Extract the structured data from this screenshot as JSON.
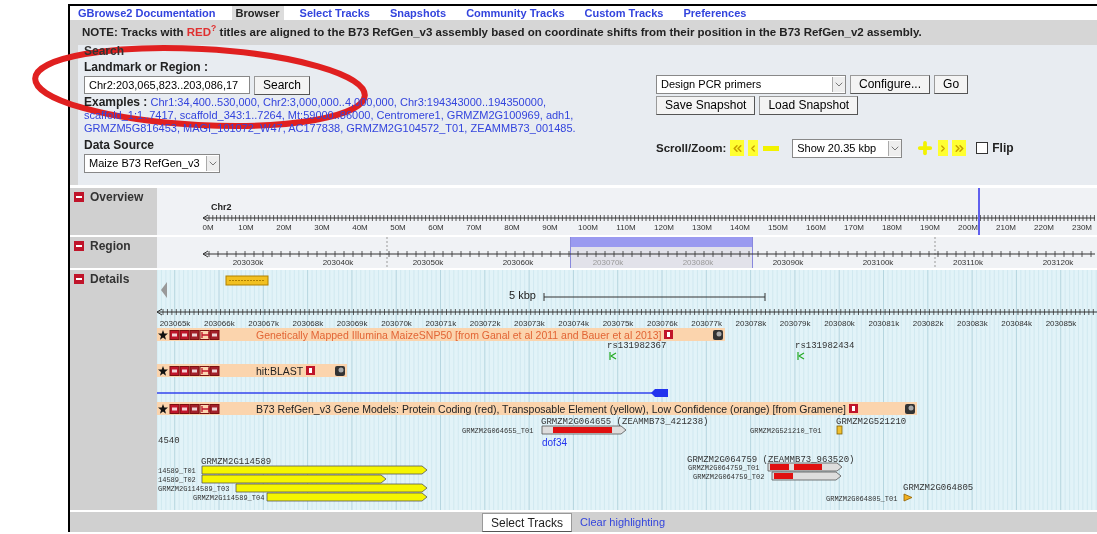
{
  "tabs": [
    {
      "label": "GBrowse2 Documentation",
      "selected": false
    },
    {
      "label": "Browser",
      "selected": true
    },
    {
      "label": "Select Tracks",
      "selected": false
    },
    {
      "label": "Snapshots",
      "selected": false
    },
    {
      "label": "Community Tracks",
      "selected": false
    },
    {
      "label": "Custom Tracks",
      "selected": false
    },
    {
      "label": "Preferences",
      "selected": false
    }
  ],
  "note": {
    "prefix": "NOTE: Tracks with",
    "highlight": "RED$^{?}$",
    "suffix": "titles are aligned to the B73 RefGen_v3 assembly based on coordinate shifts from their position in the B73 RefGen_v2 assembly."
  },
  "search": {
    "heading": "Search",
    "landmark_label": "Landmark or Region :",
    "landmark_value": "Chr2:203,065,823..203,086,17",
    "search_button": "Search",
    "examples_label": "Examples :",
    "examples": "Chr1:34,400..530,000, Chr2:3,000,000..4,000,000, Chr3:194343000..194350000, scaffold_1:1..7417, scaffold_343:1..7264, Mt:59000..86000, Centromere1, GRMZM2G100969, adh1, GRMZM5G816453, MAGI_101072_W47, AC177838, GRMZM2G104572_T01, ZEAMMB73_001485.",
    "data_source_label": "Data Source",
    "data_source": "Maize B73 RefGen_v3"
  },
  "tools": {
    "plugin": "Design PCR primers",
    "configure_button": "Configure...",
    "go_button": "Go",
    "snapshot_buttons": [
      "Save Snapshot",
      "Load Snapshot"
    ],
    "scroll_zoom_label": "Scroll/Zoom:",
    "zoom": "Show 20.35 kbp",
    "flip": {
      "label": "Flip",
      "checked": false
    }
  },
  "panels": [
    {
      "label": "Overview"
    },
    {
      "label": "Region"
    },
    {
      "label": "Details"
    }
  ],
  "overview": {
    "chromosome": "Chr2",
    "ticks": [
      "0M",
      "10M",
      "20M",
      "30M",
      "40M",
      "50M",
      "60M",
      "70M",
      "80M",
      "90M",
      "100M",
      "110M",
      "120M",
      "130M",
      "140M",
      "150M",
      "160M",
      "170M",
      "180M",
      "190M",
      "200M",
      "210M",
      "220M",
      "230M"
    ]
  },
  "region": {
    "ticks": [
      "203030k",
      "203040k",
      "203050k",
      "203060k",
      "203070k",
      "203080k",
      "203090k",
      "203100k",
      "203110k",
      "203120k"
    ]
  },
  "details": {
    "scale": "5 kbp",
    "ticks": [
      "203065k",
      "203066k",
      "203067k",
      "203068k",
      "203069k",
      "203070k",
      "203071k",
      "203072k",
      "203073k",
      "203074k",
      "203075k",
      "203076k",
      "203077k",
      "203078k",
      "203079k",
      "203080k",
      "203081k",
      "203082k",
      "203083k",
      "203084k",
      "203085k"
    ],
    "tracks": [
      {
        "title": "Genetically Mapped Illumina MaizeSNP50 [from Ganal et al 2011 and Bauer et al 2013]",
        "realigned": true
      },
      {
        "title": "hit:BLAST",
        "realigned": false
      },
      {
        "title": "B73 RefGen_v3 Gene Models: Protein Coding (red), Transposable Element (yellow), Low Confidence (orange) [from Gramene]",
        "realigned": false
      }
    ],
    "labels": [
      {
        "kind": "name",
        "text": "rs131982367"
      },
      {
        "kind": "name",
        "text": "rs131982434"
      },
      {
        "kind": "name",
        "text": "GRMZM2G064655 (ZEAMMB73_421238)"
      },
      {
        "kind": "transcript",
        "text": "GRMZM2G064655_T01"
      },
      {
        "kind": "name",
        "text": "GRMZM2G521210"
      },
      {
        "kind": "transcript",
        "text": "GRMZM2G521210_T01"
      },
      {
        "kind": "name",
        "text": "4540"
      },
      {
        "kind": "link",
        "text": "dof34"
      },
      {
        "kind": "name",
        "text": "GRMZM2G114589"
      },
      {
        "kind": "transcript",
        "text": "14589_T01"
      },
      {
        "kind": "transcript",
        "text": "14589_T02"
      },
      {
        "kind": "transcript",
        "text": "GRMZM2G114589_T03"
      },
      {
        "kind": "transcript",
        "text": "GRMZM2G114589_T04"
      },
      {
        "kind": "name",
        "text": "GRMZM2G064759 (ZEAMMB73_963520)"
      },
      {
        "kind": "transcript",
        "text": "GRMZM2G064759_T01"
      },
      {
        "kind": "transcript",
        "text": "GRMZM2G064759_T02"
      },
      {
        "kind": "name",
        "text": "GRMZM2G064805"
      },
      {
        "kind": "transcript",
        "text": "GRMZM2G064805_T01"
      }
    ]
  },
  "footer": {
    "select_button": "Select Tracks",
    "clear_link": "Clear highlighting"
  }
}
